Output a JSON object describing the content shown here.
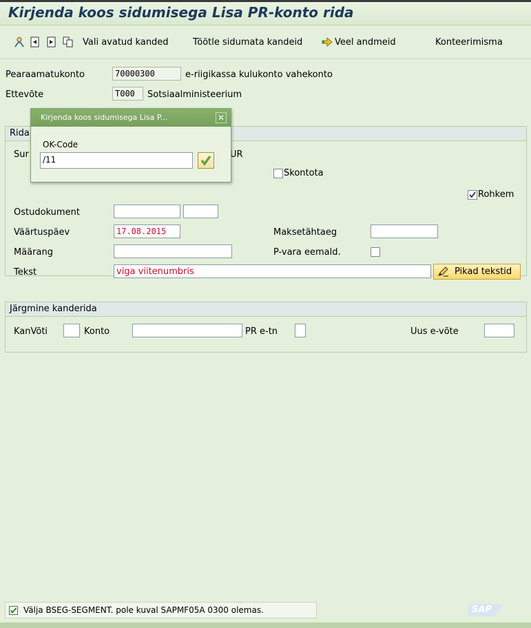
{
  "title": "Kirjenda koos sidumisega Lisa PR-konto rida",
  "toolbar": {
    "icons": [
      "person-icon",
      "previous-document-icon",
      "next-document-icon",
      "copy-icon",
      "arrow-right-icon"
    ],
    "vali_avatud_kanded": "Vali avatud kanded",
    "tootle_sidumata": "Töötle sidumata kandeid",
    "veel_andmeid": "Veel andmeid",
    "konteerimismall": "Konteerimisma"
  },
  "header": {
    "pearaamatukonto_label": "Pearaamatukonto",
    "pearaamatukonto_value": "70000300",
    "pearaamatukonto_desc": "e-riigikassa kulukonto vahekonto",
    "ettevote_label": "Ettevõte",
    "ettevote_value": "T000",
    "ettevote_desc": "Sotsiaalministeerium"
  },
  "rida_group": {
    "title": "Rida",
    "summa_label": "Sur",
    "currency": "UR",
    "skontota_label": "Skontota",
    "skontota_checked": false,
    "rohkem_label": "Rohkem",
    "rohkem_checked": true,
    "ostudokument_label": "Ostudokument",
    "vaartuspaev_label": "Väärtuspäev",
    "vaartuspaev_value": "17.08.2015",
    "maksetahtaeg_label": "Maksetähtaeg",
    "maarang_label": "Määrang",
    "pvara_label": "P-vara eemald.",
    "pvara_checked": false,
    "tekst_label": "Tekst",
    "tekst_value": "viga viitenumbris",
    "pikad_tekstid": "Pikad tekstid"
  },
  "next_group": {
    "title": "Järgmine kanderida",
    "kanvoti_label": "KanVõti",
    "konto_label": "Konto",
    "pretn_label": "PR e-tn",
    "uus_evote_label": "Uus e-võte"
  },
  "popup": {
    "title": "Kirjenda koos sidumisega Lisa P...",
    "close_label": "✕",
    "okcode_label": "OK-Code",
    "okcode_value": "/11"
  },
  "status": {
    "message": "Välja BSEG-SEGMENT. pole kuval SAPMF05A 0300 olemas.",
    "logo": "SAP"
  },
  "colors": {
    "background": "#e4efdc",
    "title_text": "#1b3a5c",
    "error_text": "#c8102e",
    "popup_header": "#76a05c"
  }
}
